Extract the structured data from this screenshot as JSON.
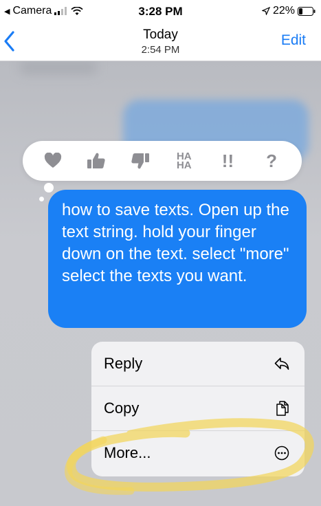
{
  "status_bar": {
    "back_app": "Camera",
    "time": "3:28 PM",
    "battery_percent": "22%"
  },
  "nav": {
    "title": "Today",
    "subtitle": "2:54 PM",
    "edit_label": "Edit"
  },
  "tapback": {
    "haha_label": "HA\nHA",
    "exclaim_label": "!!",
    "question_label": "?"
  },
  "message": {
    "text": "how to save texts. Open up the text string. hold your finger down on the text. select \"more\" select the texts you want."
  },
  "context_menu": {
    "items": [
      {
        "label": "Reply",
        "icon": "reply-icon"
      },
      {
        "label": "Copy",
        "icon": "copy-icon"
      },
      {
        "label": "More...",
        "icon": "more-icon"
      }
    ]
  },
  "colors": {
    "accent": "#1a7cf5",
    "bubble": "#1a80f5",
    "highlight": "#f3d65a"
  }
}
